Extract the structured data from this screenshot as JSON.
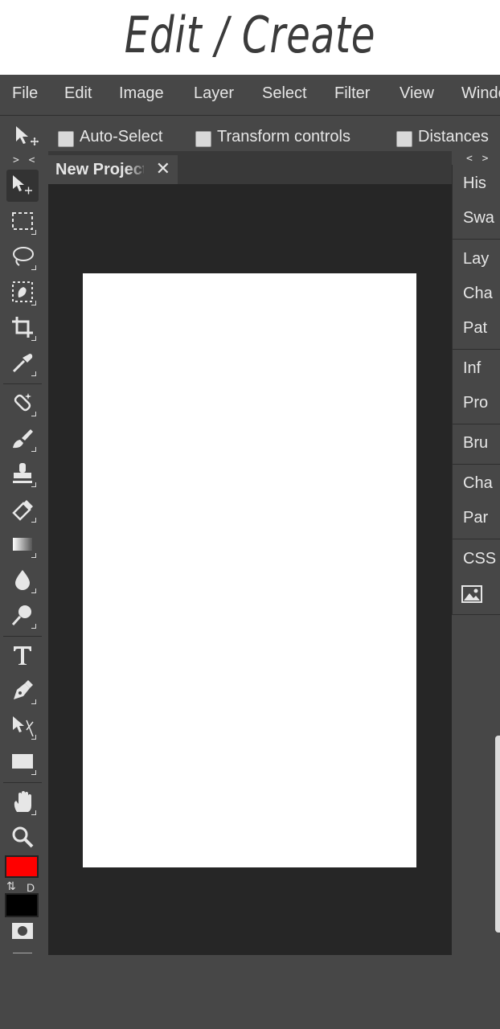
{
  "header": {
    "title": "Edit / Create"
  },
  "menu": [
    "File",
    "Edit",
    "Image",
    "Layer",
    "Select",
    "Filter",
    "View",
    "Window"
  ],
  "options": {
    "auto_select": "Auto-Select",
    "transform_controls": "Transform controls",
    "distances": "Distances"
  },
  "toolbar": {
    "collapse_label": "> <",
    "color_swap": "⇅",
    "color_default": "D",
    "foreground_color": "#ff0000",
    "background_color": "#000000"
  },
  "document": {
    "tab_label": "New Project",
    "close_symbol": "✕"
  },
  "right_panel": {
    "collapse_label": "< >",
    "groups": [
      [
        "His",
        "Swa"
      ],
      [
        "Lay",
        "Cha",
        "Pat"
      ],
      [
        "Inf",
        "Pro"
      ],
      [
        "Bru"
      ],
      [
        "Cha",
        "Par"
      ],
      [
        "CSS"
      ]
    ]
  }
}
